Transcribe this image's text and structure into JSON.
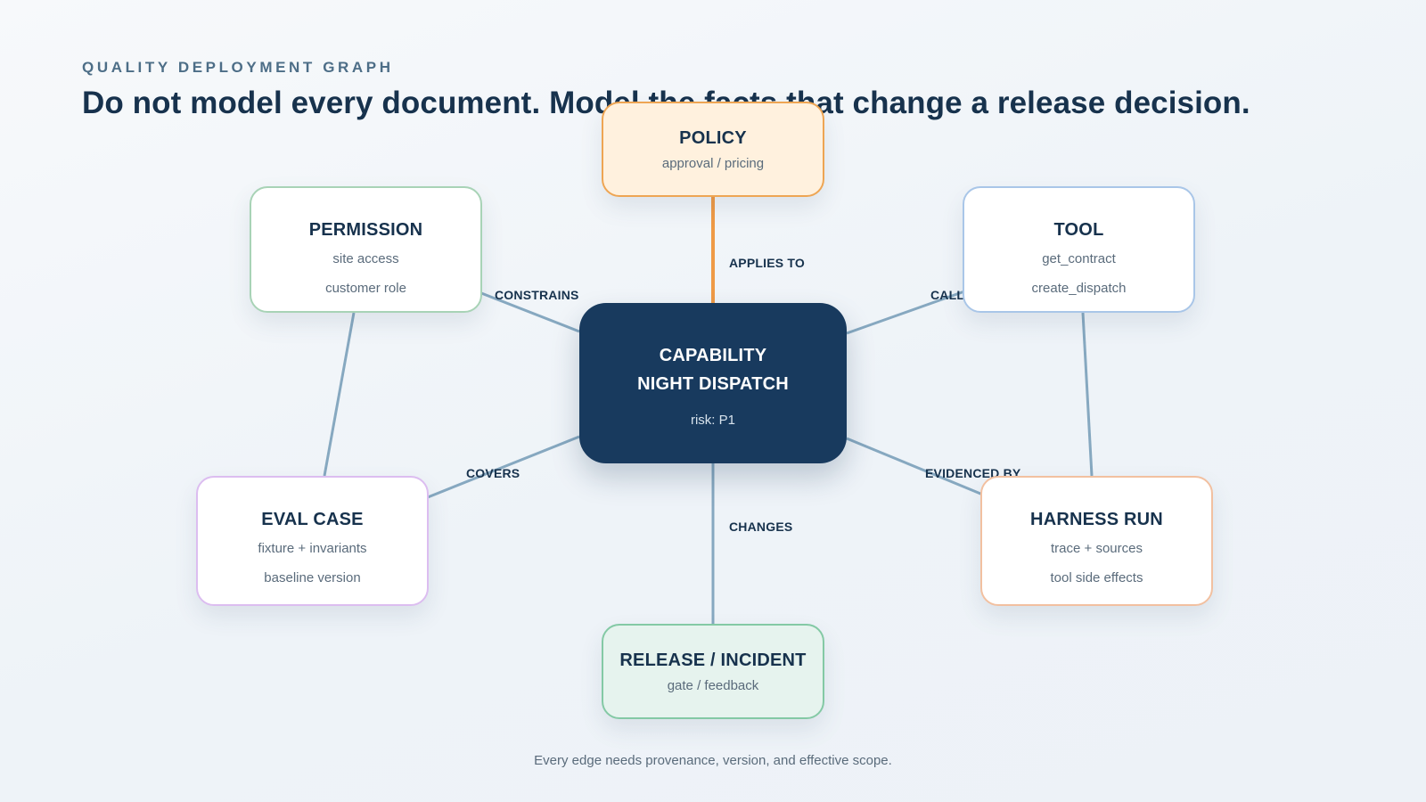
{
  "header": {
    "eyebrow": "QUALITY DEPLOYMENT GRAPH",
    "headline": "Do not model every document. Model the facts that change a release decision."
  },
  "nodes": {
    "policy": {
      "title": "POLICY",
      "lines": [
        "approval / pricing"
      ]
    },
    "permission": {
      "title": "PERMISSION",
      "lines": [
        "site access",
        "customer role"
      ]
    },
    "tool": {
      "title": "TOOL",
      "lines": [
        "get_contract",
        "create_dispatch"
      ]
    },
    "capability": {
      "title_lines": [
        "CAPABILITY",
        "NIGHT DISPATCH"
      ],
      "lines": [
        "risk: P1"
      ]
    },
    "eval_case": {
      "title": "EVAL CASE",
      "lines": [
        "fixture + invariants",
        "baseline version"
      ]
    },
    "harness_run": {
      "title": "HARNESS RUN",
      "lines": [
        "trace + sources",
        "tool side effects"
      ]
    },
    "release": {
      "title": "RELEASE / INCIDENT",
      "lines": [
        "gate / feedback"
      ]
    }
  },
  "edges": {
    "applies_to": "APPLIES TO",
    "constrains": "CONSTRAINS",
    "calls": "CALLS",
    "covers": "COVERS",
    "evidenced_by": "EVIDENCED BY",
    "changes": "CHANGES"
  },
  "colors": {
    "background": "#f3f6f9",
    "ink": "#17324d",
    "edge": "#86a8c0",
    "policy_edge": "#ef9a46",
    "capability_fill": "#183a5e",
    "policy_fill": "#fff1de",
    "release_fill": "#e6f3ee"
  },
  "footer": {
    "note": "Every edge needs provenance, version, and effective scope."
  }
}
